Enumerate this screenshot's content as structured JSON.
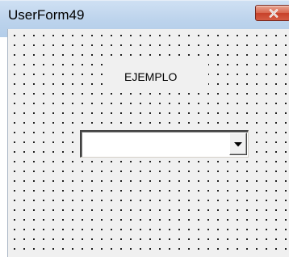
{
  "window": {
    "title": "UserForm49"
  },
  "form": {
    "label_text": "EJEMPLO",
    "combo_value": ""
  },
  "icons": {
    "close": "close-icon",
    "dropdown": "chevron-down-icon"
  },
  "colors": {
    "titlebar": "#bcd3ec",
    "close_button": "#c7412a",
    "form_background": "#f0f0f0"
  }
}
